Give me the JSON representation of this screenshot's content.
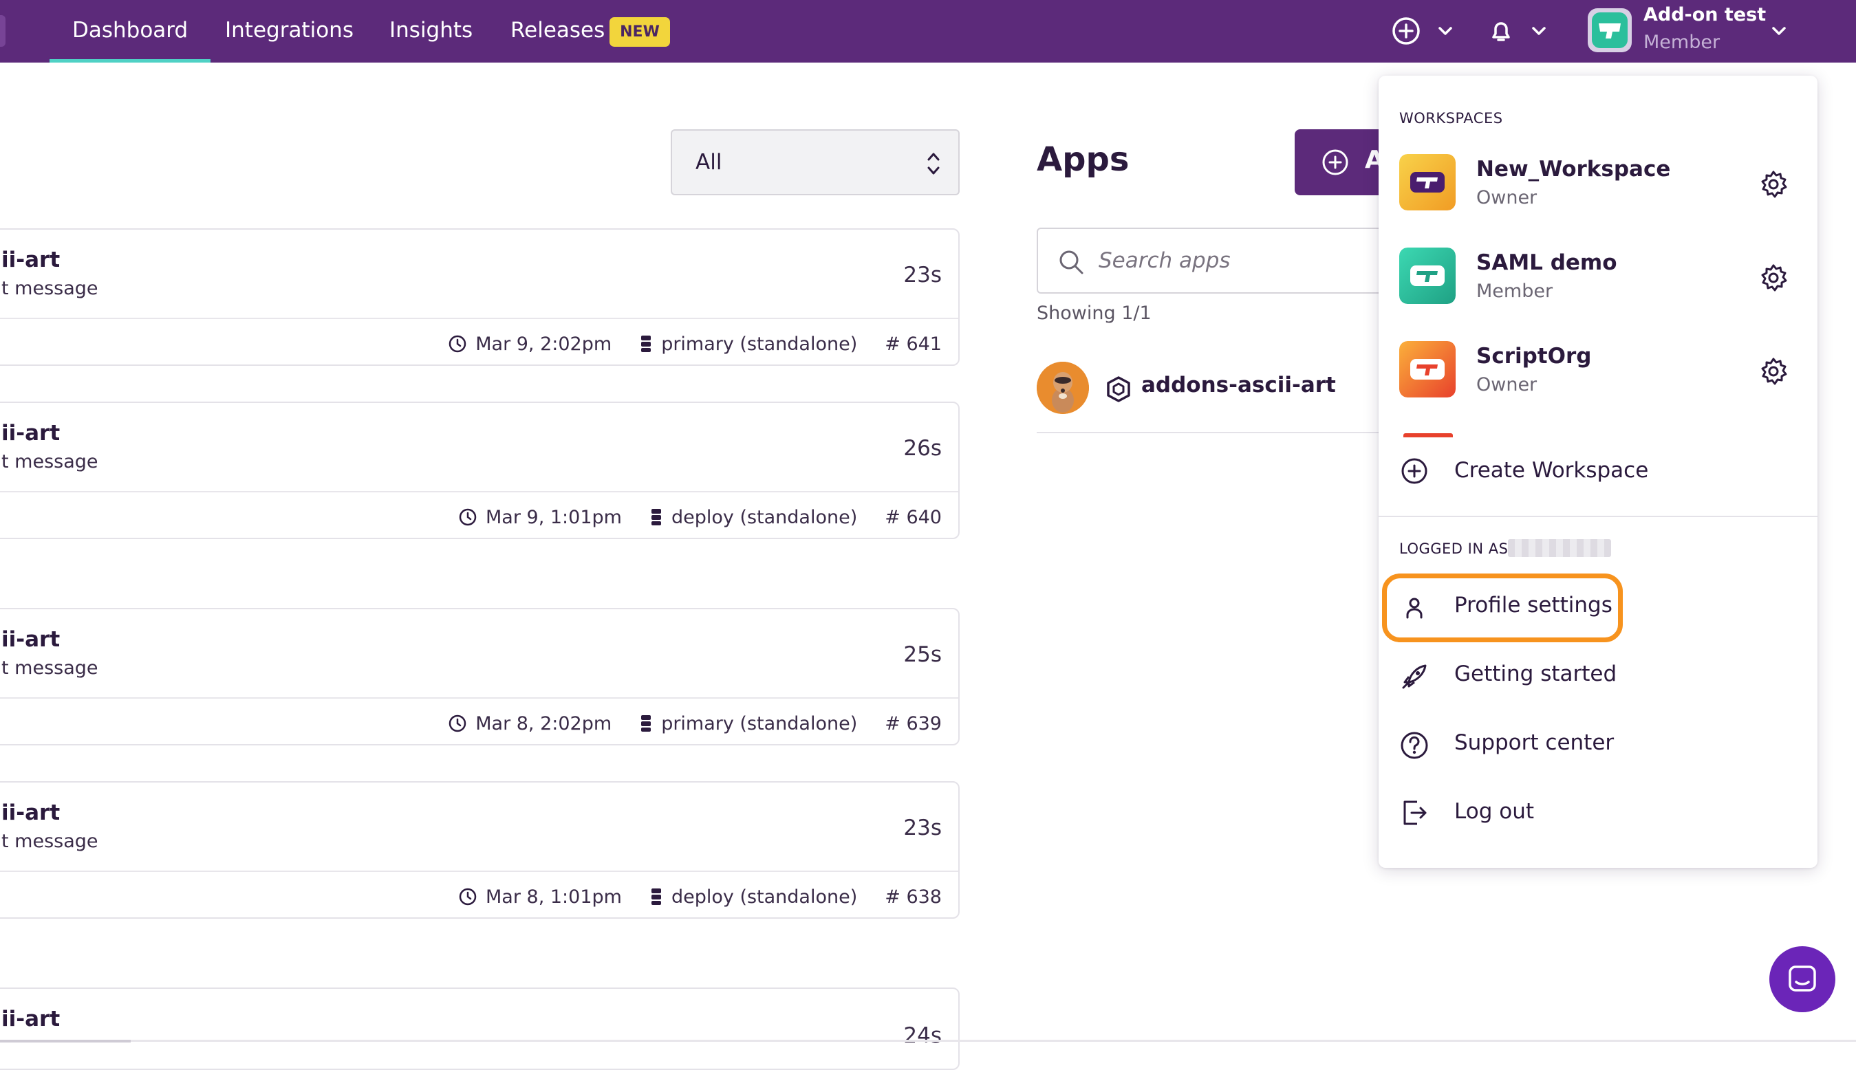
{
  "nav": {
    "tabs": [
      {
        "label": "Dashboard",
        "active": true
      },
      {
        "label": "Integrations"
      },
      {
        "label": "Insights"
      },
      {
        "label": "Releases"
      }
    ],
    "releases_badge": "NEW",
    "icons": [
      "plus-circle-icon",
      "chevron-down-icon",
      "bell-icon",
      "chevron-down-icon"
    ],
    "account": {
      "name": "Add-on test",
      "role": "Member"
    }
  },
  "filter": {
    "value": "All"
  },
  "builds": [
    {
      "title": "ii-art",
      "subtitle": "t message",
      "duration": "23s",
      "date": "Mar 9, 2:02pm",
      "workflow": "primary (standalone)",
      "number": "# 641"
    },
    {
      "title": "ii-art",
      "subtitle": "t message",
      "duration": "26s",
      "date": "Mar 9, 1:01pm",
      "workflow": "deploy (standalone)",
      "number": "# 640"
    },
    {
      "title": "ii-art",
      "subtitle": "t message",
      "duration": "25s",
      "date": "Mar 8, 2:02pm",
      "workflow": "primary (standalone)",
      "number": "# 639"
    },
    {
      "title": "ii-art",
      "subtitle": "t message",
      "duration": "23s",
      "date": "Mar 8, 1:01pm",
      "workflow": "deploy (standalone)",
      "number": "# 638"
    },
    {
      "title": "ii-art",
      "duration": "24s"
    }
  ],
  "apps": {
    "title": "Apps",
    "add_button_label": "A",
    "search_placeholder": "Search apps",
    "showing": "Showing 1/1",
    "items": [
      {
        "name": "addons-ascii-art"
      }
    ]
  },
  "dropdown": {
    "workspaces_label": "WORKSPACES",
    "workspaces": [
      {
        "name": "New_Workspace",
        "role": "Owner",
        "color": "#f5b731"
      },
      {
        "name": "SAML demo",
        "role": "Member",
        "color": "#2bbf9c"
      },
      {
        "name": "ScriptOrg",
        "role": "Owner",
        "color": "#f47a2a"
      }
    ],
    "create_workspace": "Create Workspace",
    "logged_in_as": "LOGGED IN AS",
    "menu": [
      {
        "label": "Profile settings",
        "icon": "user-icon",
        "highlighted": true
      },
      {
        "label": "Getting started",
        "icon": "rocket-icon"
      },
      {
        "label": "Support center",
        "icon": "question-circle-icon"
      },
      {
        "label": "Log out",
        "icon": "logout-icon"
      }
    ]
  },
  "colors": {
    "nav_bg": "#5c2a7a",
    "active_underline": "#4fd1c5",
    "badge_bg": "#f2d53c",
    "highlight": "#f7931e",
    "chat_fab": "#6b25b8"
  }
}
